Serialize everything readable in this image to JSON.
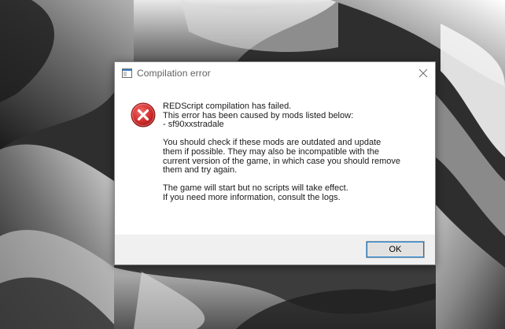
{
  "window": {
    "title": "Compilation error",
    "app_icon": "window-app-icon",
    "close_icon": "close-icon"
  },
  "message": {
    "icon": "error-icon",
    "lines": {
      "l1": "REDScript compilation has failed.",
      "l2": "This error has been caused by mods listed below:",
      "l3": "- sf90xxstradale",
      "l4": "You should check if these mods are outdated and update",
      "l5": "them if possible. They may also be incompatible with the",
      "l6": "current version of the game, in which case you should remove",
      "l7": "them and try again.",
      "l8": "The game will start but no scripts will take effect.",
      "l9": "If you need more information, consult the logs."
    }
  },
  "footer": {
    "ok_label": "OK"
  },
  "colors": {
    "error_red": "#d32f2f",
    "focus_blue": "#0078d7",
    "footer_bg": "#f0f0f0"
  }
}
